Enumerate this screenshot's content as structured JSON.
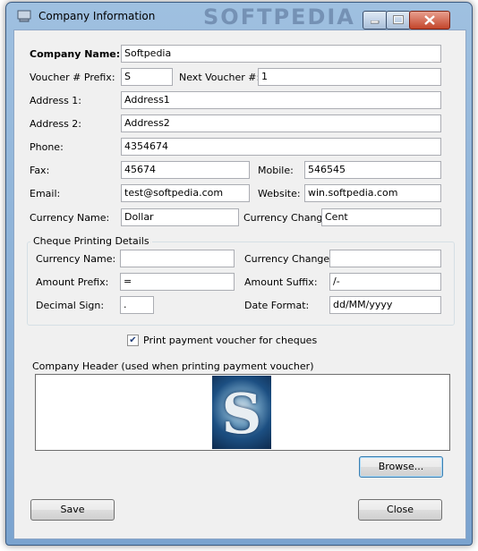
{
  "window": {
    "title": "Company Information",
    "watermark": "SOFTPEDIA"
  },
  "company": {
    "name_label": "Company Name:",
    "name_value": "Softpedia",
    "voucher_prefix_label": "Voucher # Prefix:",
    "voucher_prefix_value": "S",
    "next_voucher_label": "Next Voucher #:",
    "next_voucher_value": "1",
    "address1_label": "Address 1:",
    "address1_value": "Address1",
    "address2_label": "Address 2:",
    "address2_value": "Address2",
    "phone_label": "Phone:",
    "phone_value": "4354674",
    "fax_label": "Fax:",
    "fax_value": "45674",
    "mobile_label": "Mobile:",
    "mobile_value": "546545",
    "email_label": "Email:",
    "email_value": "test@softpedia.com",
    "website_label": "Website:",
    "website_value": "win.softpedia.com",
    "currency_name_label": "Currency Name:",
    "currency_name_value": "Dollar",
    "currency_change_label": "Currency Change:",
    "currency_change_value": "Cent"
  },
  "cheque": {
    "group_title": "Cheque Printing Details",
    "currency_name_label": "Currency Name:",
    "currency_name_value": "",
    "currency_change_label": "Currency Change:",
    "currency_change_value": "",
    "amount_prefix_label": "Amount Prefix:",
    "amount_prefix_value": "=",
    "amount_suffix_label": "Amount Suffix:",
    "amount_suffix_value": "/-",
    "decimal_sign_label": "Decimal Sign:",
    "decimal_sign_value": ".",
    "date_format_label": "Date Format:",
    "date_format_value": "dd/MM/yyyy"
  },
  "print_voucher": {
    "label": "Print payment voucher for cheques",
    "checked": true
  },
  "header": {
    "label": "Company Header  (used when printing payment voucher)",
    "logo_letter": "S"
  },
  "buttons": {
    "browse": "Browse...",
    "save": "Save",
    "close": "Close"
  }
}
